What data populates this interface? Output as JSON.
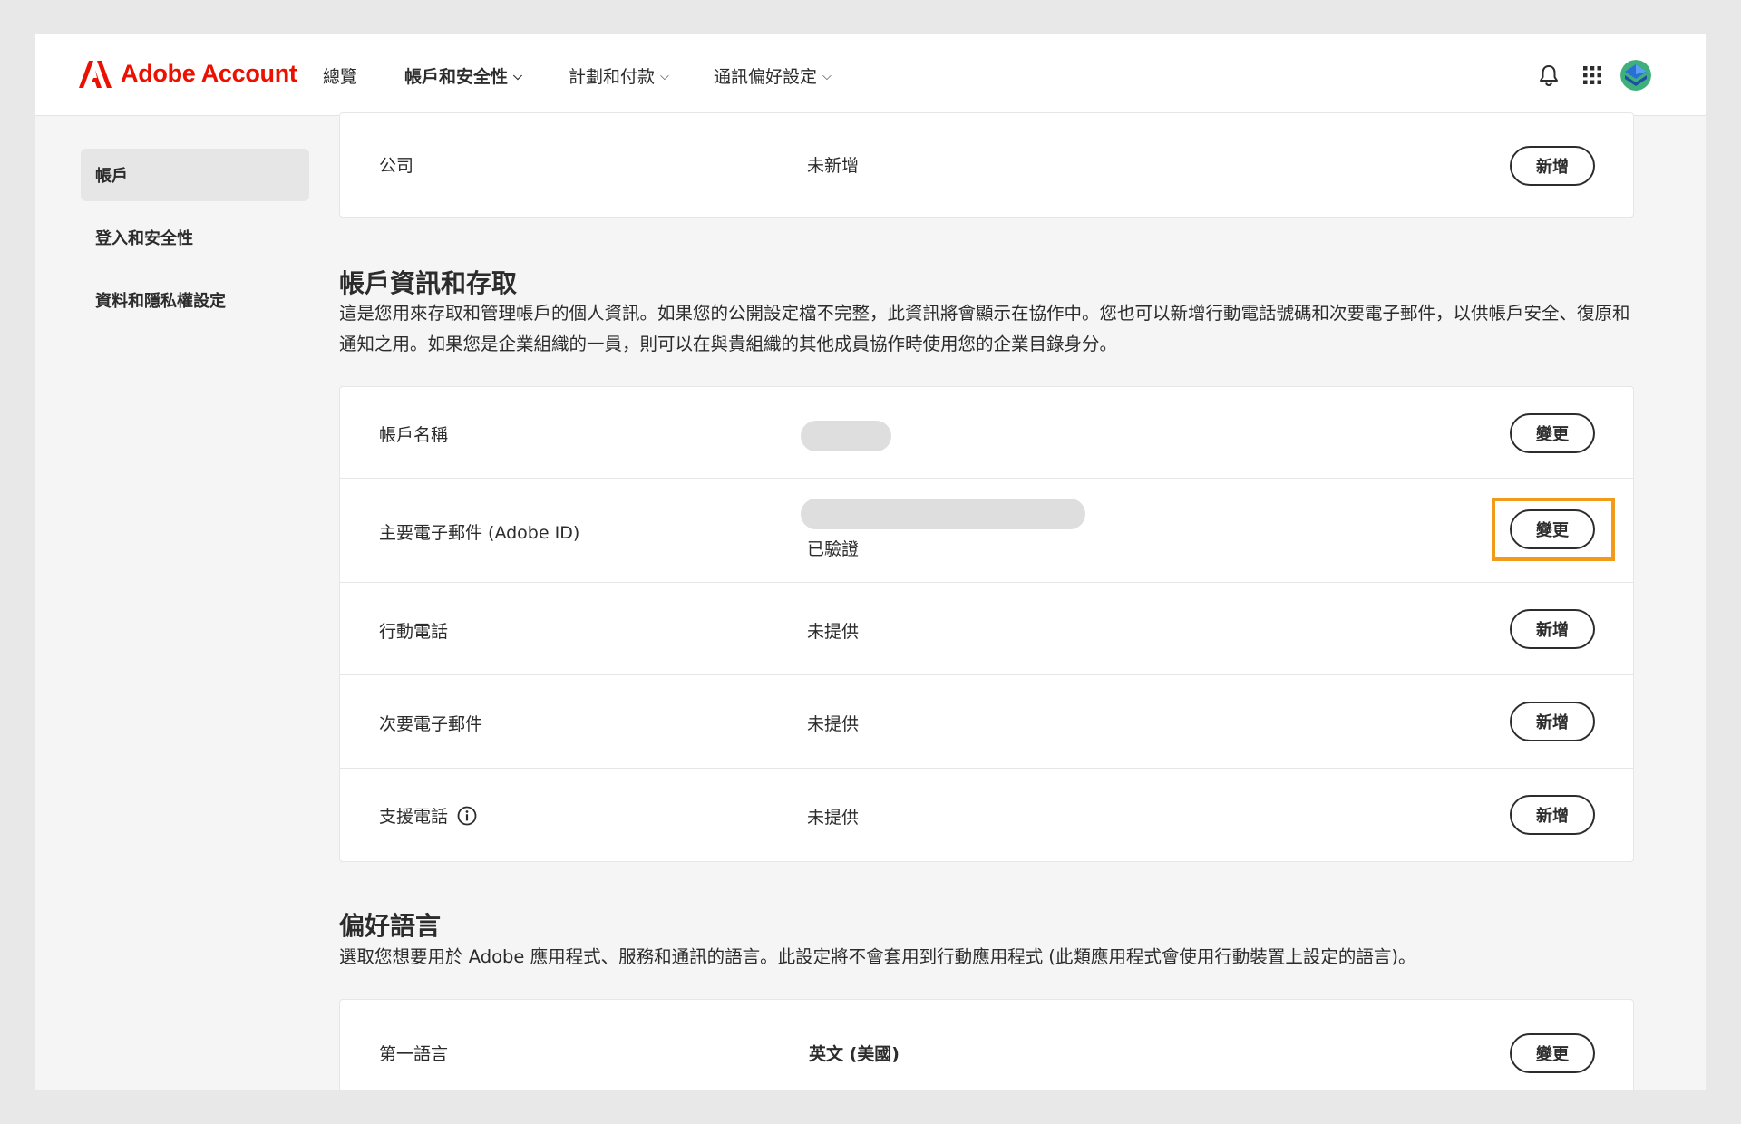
{
  "header": {
    "brand": "Adobe Account",
    "nav": [
      {
        "label": "總覽",
        "dropdown": false,
        "active": false
      },
      {
        "label": "帳戶和安全性",
        "dropdown": true,
        "active": true
      },
      {
        "label": "計劃和付款",
        "dropdown": true,
        "active": false
      },
      {
        "label": "通訊偏好設定",
        "dropdown": true,
        "active": false
      }
    ],
    "icons": [
      "bell-icon",
      "apps-grid-icon",
      "avatar"
    ]
  },
  "sidebar": {
    "items": [
      {
        "label": "帳戶",
        "active": true
      },
      {
        "label": "登入和安全性",
        "active": false
      },
      {
        "label": "資料和隱私權設定",
        "active": false
      }
    ]
  },
  "company_card": {
    "label": "公司",
    "value": "未新增",
    "button": "新增"
  },
  "account_section": {
    "title": "帳戶資訊和存取",
    "description": "這是您用來存取和管理帳戶的個人資訊。如果您的公開設定檔不完整，此資訊將會顯示在協作中。您也可以新增行動電話號碼和次要電子郵件，以供帳戶安全、復原和通知之用。如果您是企業組織的一員，則可以在與貴組織的其他成員協作時使用您的企業目錄身分。",
    "rows": [
      {
        "label": "帳戶名稱",
        "value": "",
        "button": "變更"
      },
      {
        "label": "主要電子郵件 (Adobe ID)",
        "value": "已驗證",
        "button": "變更"
      },
      {
        "label": "行動電話",
        "value": "未提供",
        "button": "新增"
      },
      {
        "label": "次要電子郵件",
        "value": "未提供",
        "button": "新增"
      },
      {
        "label": "支援電話",
        "value": "未提供",
        "button": "新增"
      }
    ]
  },
  "language_section": {
    "title": "偏好語言",
    "description": "選取您想要用於 Adobe 應用程式、服務和通訊的語言。此設定將不會套用到行動應用程式 (此類應用程式會使用行動裝置上設定的語言)。",
    "rows": [
      {
        "label": "第一語言",
        "value": "英文 (美國)",
        "button": "變更"
      }
    ]
  },
  "colors": {
    "brand_red": "#eb1000",
    "highlight_orange": "#f29a1a"
  }
}
